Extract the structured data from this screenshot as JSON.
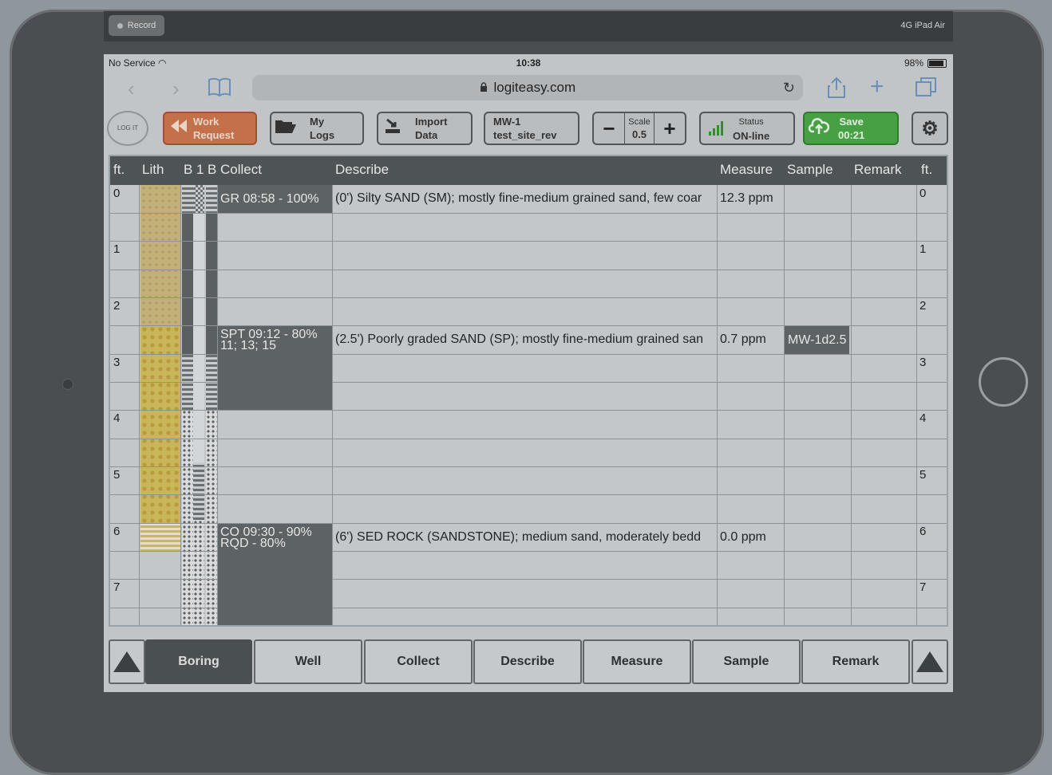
{
  "recorder": {
    "record_label": "Record",
    "device": "4G  iPad Air"
  },
  "statusbar": {
    "carrier": "No Service",
    "wifi_icon": "◠",
    "time": "10:38",
    "battery": "98%"
  },
  "browser": {
    "url": "logiteasy.com",
    "lock_icon": "🔒",
    "reload_icon": "↻",
    "back_icon": "‹",
    "forward_icon": "›",
    "bookmarks_icon": "🕮",
    "share_icon": "⇧",
    "add_icon": "+",
    "tabs_icon": "⧉"
  },
  "toolbar": {
    "logo": "LOG IT EASY",
    "work_request": "Work\nRequest",
    "my_logs": "My\nLogs",
    "import_data": "Import\nData",
    "log_name": "MW-1\ntest_site_rev",
    "scale_label": "Scale",
    "scale_value": "0.5",
    "minus": "−",
    "plus": "+",
    "status_label": "Status",
    "status_value": "ON-line",
    "save_label": "Save",
    "save_timer": "00:21",
    "settings_icon": "⚙"
  },
  "table": {
    "headers": [
      "ft.",
      "Lith",
      "B",
      "1",
      "B",
      "Collect",
      "Describe",
      "Measure",
      "Sample",
      "Remark",
      "ft."
    ],
    "ft_labels": [
      "0",
      "1",
      "2",
      "3",
      "4",
      "5",
      "6",
      "7"
    ],
    "rows": [
      {
        "collect": "GR 08:58 - 100%",
        "describe": "(0') Silty SAND (SM); mostly fine-medium grained sand, few coar",
        "measure": "12.3 ppm",
        "sample": ""
      },
      {
        "collect": "SPT 09:12 - 80%\n11; 13; 15",
        "describe": "(2.5') Poorly graded SAND (SP); mostly fine-medium grained san",
        "measure": "0.7 ppm",
        "sample": "MW-1d2.5"
      },
      {
        "collect": "CO 09:30 - 90%\nRQD - 80%",
        "describe": "(6') SED ROCK (SANDSTONE); medium sand, moderately bedd",
        "measure": "0.0 ppm",
        "sample": ""
      }
    ]
  },
  "tabs": [
    "Boring",
    "Well",
    "Collect",
    "Describe",
    "Measure",
    "Sample",
    "Remark"
  ],
  "active_tab": "Boring"
}
